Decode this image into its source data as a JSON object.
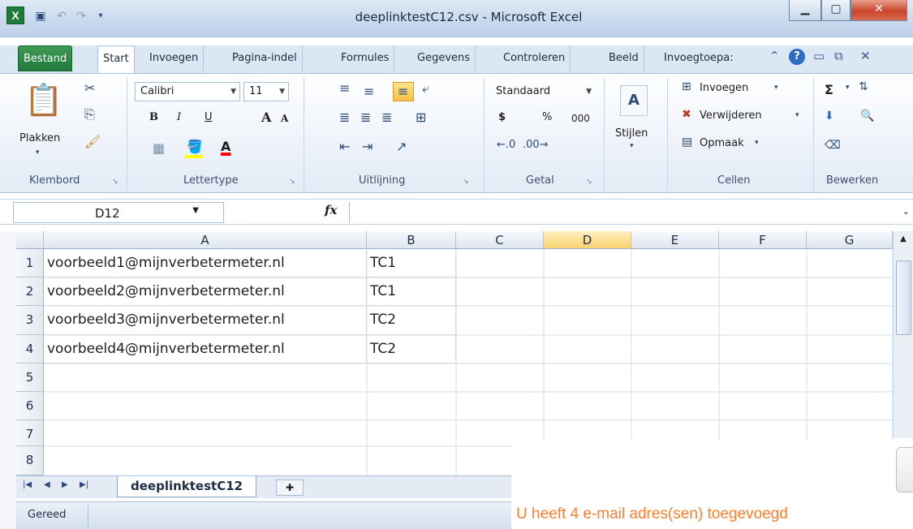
{
  "window": {
    "app_icon": "X",
    "title": "deeplinktestC12.csv - Microsoft Excel",
    "minimize_icon": "minimize-icon",
    "maximize_icon": "maximize-icon",
    "close_icon": "close-icon"
  },
  "ribbon_tabs": [
    "Bestand",
    "Start",
    "Invoegen",
    "Pagina-indel",
    "Formules",
    "Gegevens",
    "Controleren",
    "Beeld",
    "Invoegtoepa:"
  ],
  "ribbon": {
    "clipboard": {
      "paste": "Plakken",
      "label": "Klembord"
    },
    "font": {
      "family": "Calibri",
      "size": "11",
      "bold": "B",
      "italic": "I",
      "underline": "U",
      "grow": "A",
      "shrink": "A",
      "color_letter": "A",
      "label": "Lettertype",
      "fill_color": "#ffff00",
      "font_color": "#ff0000"
    },
    "alignment": {
      "label": "Uitlijning"
    },
    "number": {
      "format": "Standaard",
      "currency": "$",
      "percent": "%",
      "thousands": "000",
      "label": "Getal"
    },
    "styles": {
      "label": "Stijlen"
    },
    "cells": {
      "insert": "Invoegen",
      "delete": "Verwijderen",
      "format": "Opmaak",
      "label": "Cellen"
    },
    "editing": {
      "sum": "Σ",
      "label": "Bewerken"
    }
  },
  "formula_bar": {
    "name_box": "D12",
    "fx": "fx",
    "value": ""
  },
  "sheet": {
    "columns": [
      "A",
      "B",
      "C",
      "D",
      "E",
      "F",
      "G"
    ],
    "selected_column": "D",
    "rows": [
      {
        "num": "1",
        "a": "voorbeeld1@mijnverbetermeter.nl",
        "b": "TC1"
      },
      {
        "num": "2",
        "a": "voorbeeld2@mijnverbetermeter.nl",
        "b": "TC1"
      },
      {
        "num": "3",
        "a": "voorbeeld3@mijnverbetermeter.nl",
        "b": "TC2"
      },
      {
        "num": "4",
        "a": "voorbeeld4@mijnverbetermeter.nl",
        "b": "TC2"
      },
      {
        "num": "5",
        "a": "",
        "b": ""
      },
      {
        "num": "6",
        "a": "",
        "b": ""
      },
      {
        "num": "7",
        "a": "",
        "b": ""
      },
      {
        "num": "8",
        "a": "",
        "b": ""
      }
    ]
  },
  "sheet_tabs": {
    "active": "deeplinktestC12"
  },
  "status_bar": {
    "status": "Gereed"
  },
  "overlay": {
    "message": "U heeft 4 e-mail adres(sen) toegevoegd",
    "accent": "#ff7f2a"
  }
}
